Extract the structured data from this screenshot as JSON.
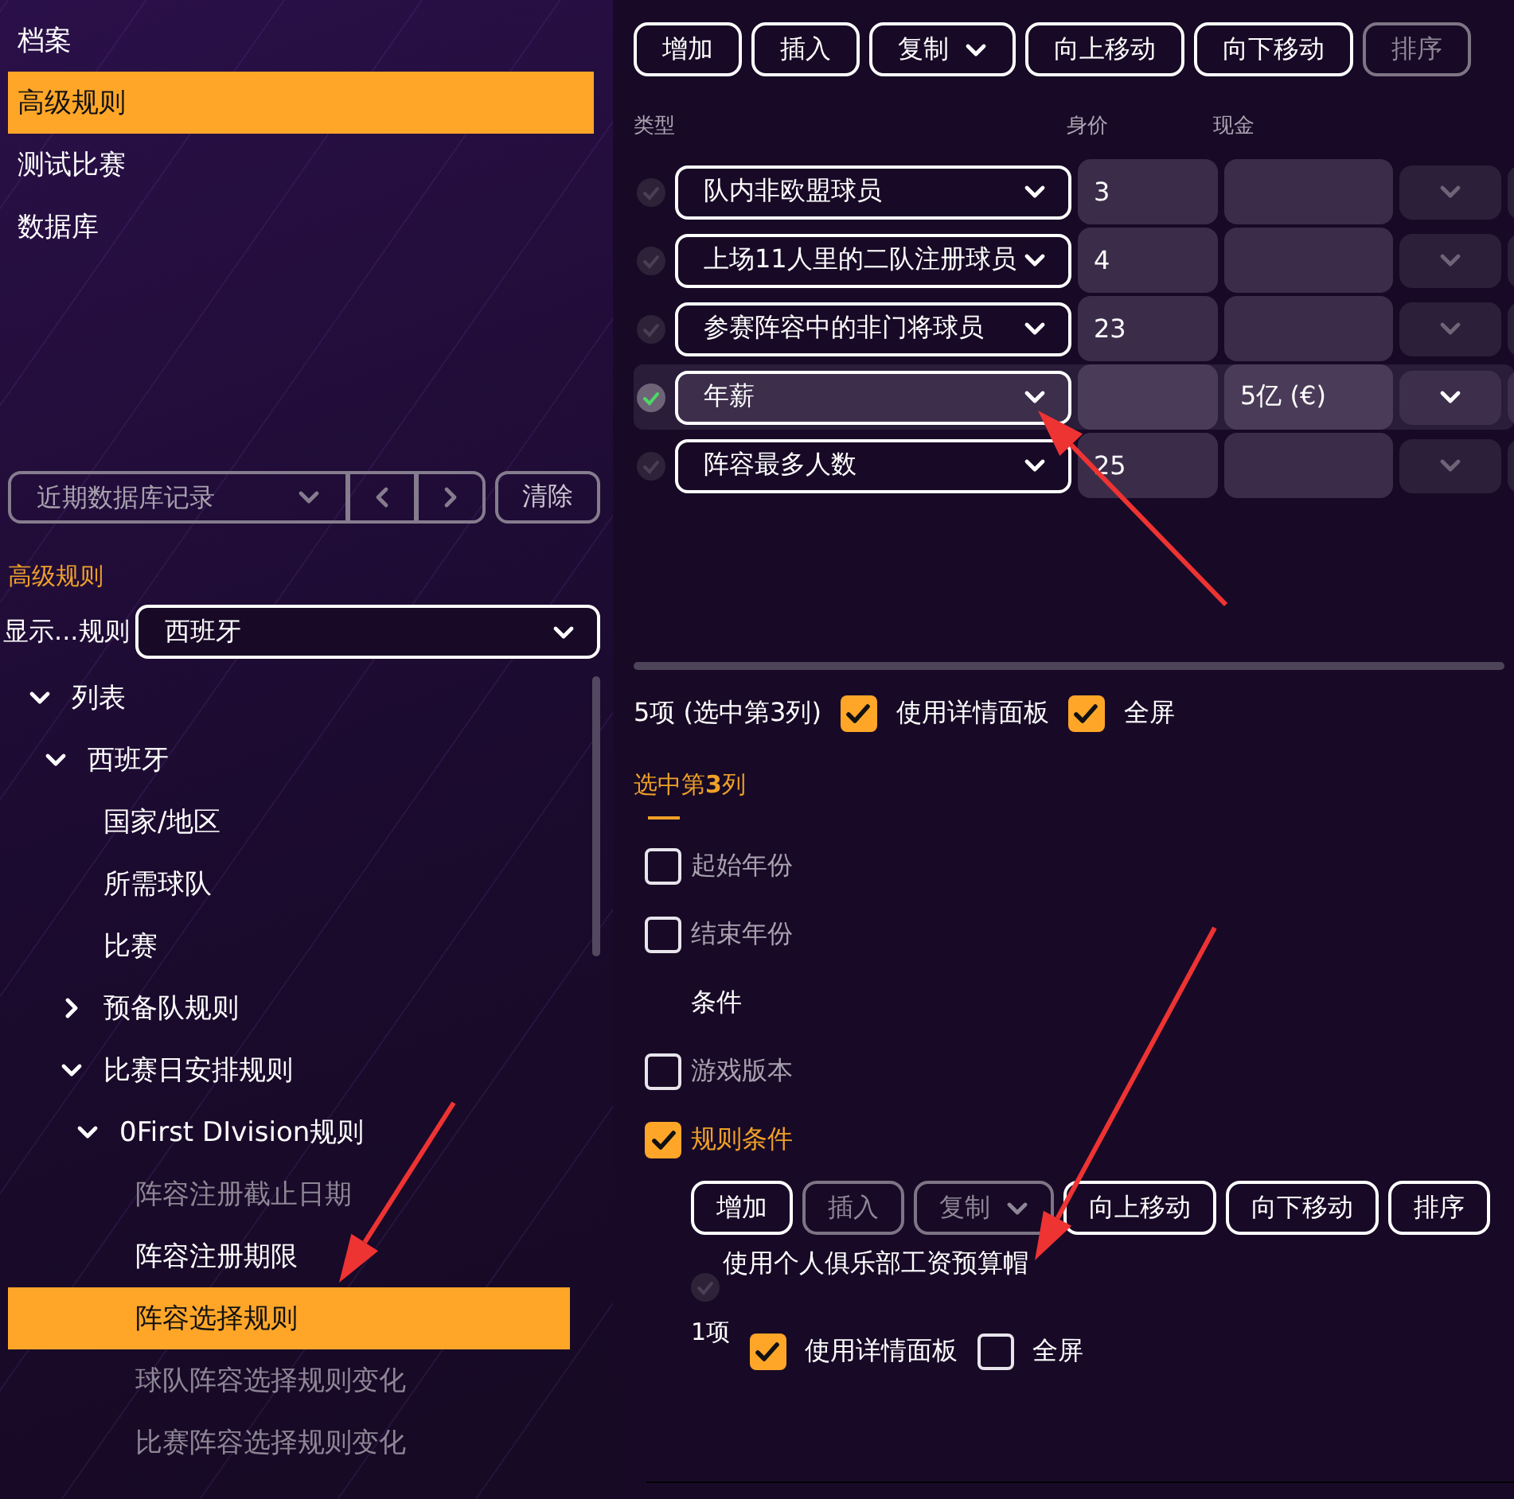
{
  "nav": [
    {
      "label": "档案",
      "selected": false
    },
    {
      "label": "高级规则",
      "selected": true
    },
    {
      "label": "测试比赛",
      "selected": false
    },
    {
      "label": "数据库",
      "selected": false
    }
  ],
  "history": {
    "placeholder": "近期数据库记录",
    "clear_button": "清除"
  },
  "section_title": "高级规则",
  "filter": {
    "label": "显示...规则",
    "value": "西班牙"
  },
  "tree": [
    {
      "label": "列表",
      "expanded": true,
      "selected": false,
      "disabled": false,
      "children": [
        {
          "label": "西班牙",
          "expanded": true,
          "selected": false,
          "disabled": false,
          "children": [
            {
              "label": "国家/地区",
              "selected": false,
              "disabled": false
            },
            {
              "label": "所需球队",
              "selected": false,
              "disabled": false
            },
            {
              "label": "比赛",
              "selected": false,
              "disabled": false
            },
            {
              "label": "预备队规则",
              "expanded": false,
              "selected": false,
              "disabled": false
            },
            {
              "label": "比赛日安排规则",
              "expanded": true,
              "selected": false,
              "disabled": false,
              "children": [
                {
                  "label": "0First DIvision规则",
                  "expanded": true,
                  "selected": false,
                  "disabled": false,
                  "children": [
                    {
                      "label": "阵容注册截止日期",
                      "selected": false,
                      "disabled": true
                    },
                    {
                      "label": "阵容注册期限",
                      "selected": false,
                      "disabled": false
                    },
                    {
                      "label": "阵容选择规则",
                      "selected": true,
                      "disabled": false
                    },
                    {
                      "label": "球队阵容选择规则变化",
                      "selected": false,
                      "disabled": true
                    },
                    {
                      "label": "比赛阵容选择规则变化",
                      "selected": false,
                      "disabled": true
                    }
                  ]
                }
              ]
            }
          ]
        }
      ]
    }
  ],
  "toolbar": [
    {
      "label": "增加",
      "disabled": false,
      "dropdown": false
    },
    {
      "label": "插入",
      "disabled": false,
      "dropdown": false
    },
    {
      "label": "复制",
      "disabled": false,
      "dropdown": true
    },
    {
      "label": "向上移动",
      "disabled": false,
      "dropdown": false
    },
    {
      "label": "向下移动",
      "disabled": false,
      "dropdown": false
    },
    {
      "label": "排序",
      "disabled": true,
      "dropdown": false
    }
  ],
  "columns": [
    "类型",
    "身价",
    "现金"
  ],
  "rows": [
    {
      "type": "队内非欧盟球员",
      "value": "3",
      "selected": false
    },
    {
      "type": "上场11人里的二队注册球员",
      "value": "4",
      "selected": false
    },
    {
      "type": "参赛阵容中的非门将球员",
      "value": "23",
      "selected": false
    },
    {
      "type": "年薪",
      "cash": "5亿 (€)",
      "selected": true
    },
    {
      "type": "阵容最多人数",
      "value": "25",
      "selected": false
    }
  ],
  "summary": {
    "count": "5项 (选中第3列)",
    "options": [
      {
        "label": "使用详情面板",
        "checked": true
      },
      {
        "label": "全屏",
        "checked": true
      }
    ]
  },
  "detail": {
    "title": "选中第**3**列",
    "fields": [
      {
        "kind": "checkbox",
        "label": "起始年份",
        "checked": false
      },
      {
        "kind": "checkbox",
        "label": "结束年份",
        "checked": false
      },
      {
        "kind": "label",
        "label": "条件"
      },
      {
        "kind": "checkbox",
        "label": "游戏版本",
        "checked": false
      },
      {
        "kind": "checkbox",
        "label": "规则条件",
        "checked": true
      }
    ]
  },
  "conditions": {
    "toolbar": [
      {
        "label": "增加",
        "disabled": false,
        "dropdown": false
      },
      {
        "label": "插入",
        "disabled": true,
        "dropdown": false
      },
      {
        "label": "复制",
        "disabled": true,
        "dropdown": true
      },
      {
        "label": "向上移动",
        "disabled": false,
        "dropdown": false
      },
      {
        "label": "向下移动",
        "disabled": false,
        "dropdown": false
      },
      {
        "label": "排序",
        "disabled": false,
        "dropdown": false
      }
    ],
    "items": [
      {
        "label": "使用个人俱乐部工资预算帽",
        "selected": false
      }
    ],
    "count": "1项",
    "options": [
      {
        "label": "使用详情面板",
        "checked": true
      },
      {
        "label": "全屏",
        "checked": false
      }
    ]
  },
  "annotations": [
    {
      "kind": "arrow"
    },
    {
      "kind": "arrow"
    },
    {
      "kind": "arrow"
    }
  ]
}
